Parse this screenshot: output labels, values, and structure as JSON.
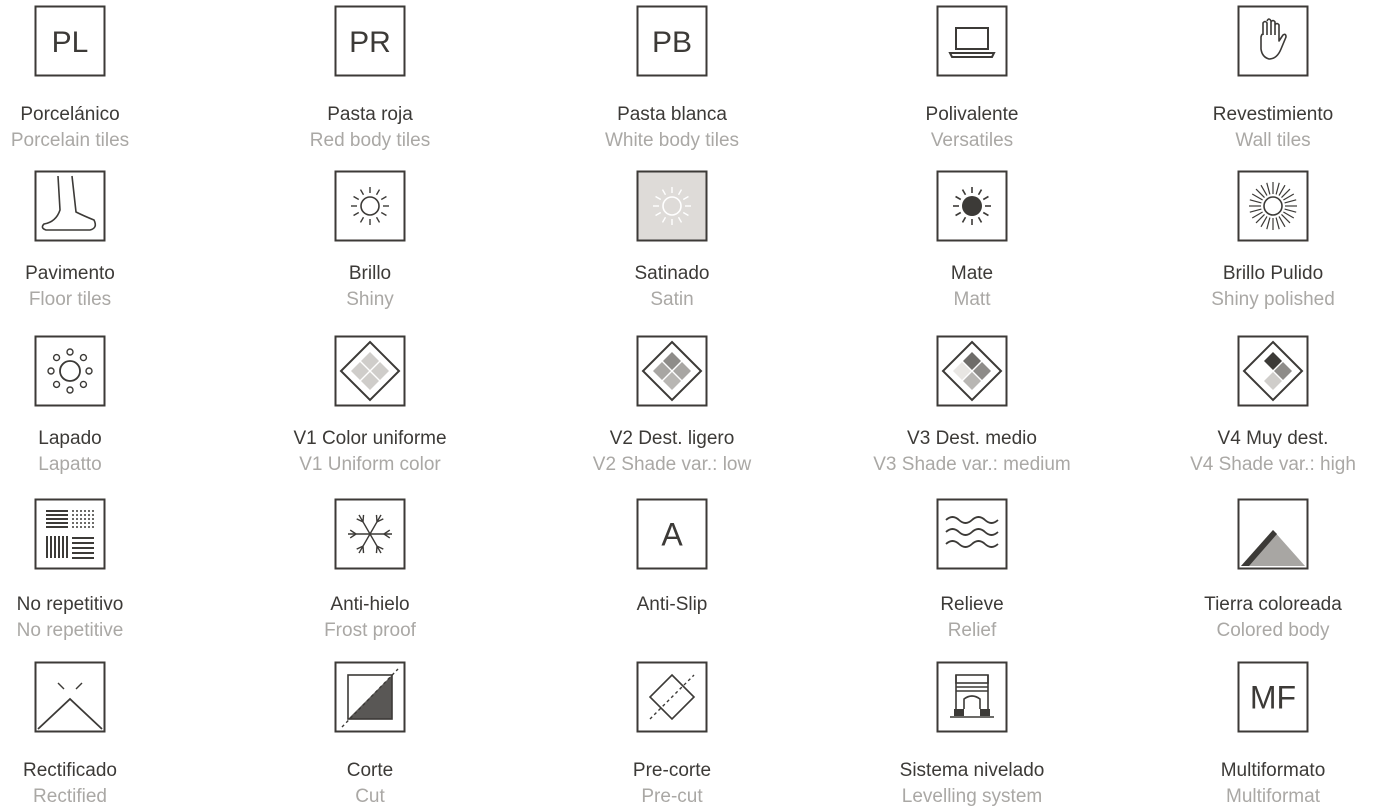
{
  "colors": {
    "stroke": "#3c3a37",
    "label_primary": "#3c3a37",
    "label_secondary": "#aaa8a5",
    "satin_fill": "#dedbd8"
  },
  "items": [
    {
      "es": "Porcelánico",
      "en": "Porcelain tiles",
      "icon": "pl-text-icon",
      "glyph": "PL"
    },
    {
      "es": "Pasta roja",
      "en": "Red body tiles",
      "icon": "pr-text-icon",
      "glyph": "PR"
    },
    {
      "es": "Pasta blanca",
      "en": "White body tiles",
      "icon": "pb-text-icon",
      "glyph": "PB"
    },
    {
      "es": "Polivalente",
      "en": "Versatiles",
      "icon": "laptop-icon"
    },
    {
      "es": "Revestimiento",
      "en": "Wall tiles",
      "icon": "hand-icon"
    },
    {
      "es": "Pavimento",
      "en": "Floor tiles",
      "icon": "foot-icon"
    },
    {
      "es": "Brillo",
      "en": "Shiny",
      "icon": "sun-outline-icon"
    },
    {
      "es": "Satinado",
      "en": "Satin",
      "icon": "sun-satin-icon"
    },
    {
      "es": "Mate",
      "en": "Matt",
      "icon": "sun-filled-icon"
    },
    {
      "es": "Brillo Pulido",
      "en": "Shiny polished",
      "icon": "sun-polished-icon"
    },
    {
      "es": "Lapado",
      "en": "Lapatto",
      "icon": "lapado-icon"
    },
    {
      "es": "V1 Color uniforme",
      "en": "V1 Uniform color",
      "icon": "shade-v1-icon"
    },
    {
      "es": "V2 Dest. ligero",
      "en": "V2 Shade var.: low",
      "icon": "shade-v2-icon"
    },
    {
      "es": "V3 Dest. medio",
      "en": "V3 Shade var.: medium",
      "icon": "shade-v3-icon"
    },
    {
      "es": "V4 Muy dest.",
      "en": "V4 Shade var.: high",
      "icon": "shade-v4-icon"
    },
    {
      "es": "No repetitivo",
      "en": "No repetitive",
      "icon": "pattern-icon"
    },
    {
      "es": "Anti-hielo",
      "en": "Frost proof",
      "icon": "snowflake-icon"
    },
    {
      "es": "Anti-Slip",
      "en": "",
      "icon": "a-text-icon",
      "glyph": "A"
    },
    {
      "es": "Relieve",
      "en": "Relief",
      "icon": "waves-icon"
    },
    {
      "es": "Tierra coloreada",
      "en": "Colored body",
      "icon": "colored-body-icon"
    },
    {
      "es": "Rectificado",
      "en": "Rectified",
      "icon": "rectified-icon"
    },
    {
      "es": "Corte",
      "en": "Cut",
      "icon": "cut-icon"
    },
    {
      "es": "Pre-corte",
      "en": "Pre-cut",
      "icon": "precut-icon"
    },
    {
      "es": "Sistema nivelado",
      "en": "Levelling system",
      "icon": "levelling-icon"
    },
    {
      "es": "Multiformato",
      "en": "Multiformat",
      "icon": "mf-text-icon",
      "glyph": "MF"
    }
  ]
}
